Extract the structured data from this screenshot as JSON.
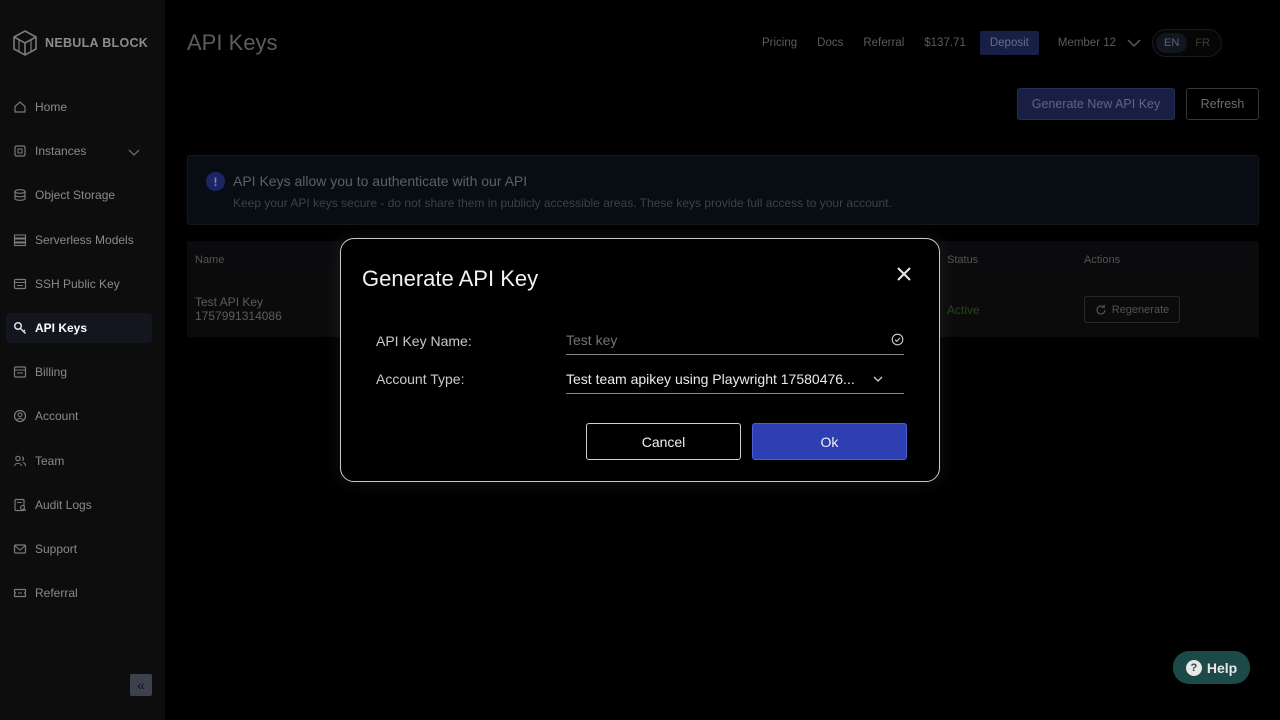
{
  "brand": {
    "name": "NEBULA BLOCK"
  },
  "sidebar": {
    "items": [
      {
        "label": "Home",
        "icon": "home-icon"
      },
      {
        "label": "Instances",
        "icon": "server-icon",
        "expandable": true
      },
      {
        "label": "Object Storage",
        "icon": "database-icon"
      },
      {
        "label": "Serverless Models",
        "icon": "layers-icon"
      },
      {
        "label": "SSH Public Key",
        "icon": "terminal-icon"
      },
      {
        "label": "API Keys",
        "icon": "key-icon",
        "active": true
      },
      {
        "label": "Billing",
        "icon": "billing-icon"
      },
      {
        "label": "Account",
        "icon": "account-icon"
      },
      {
        "label": "Team",
        "icon": "team-icon"
      },
      {
        "label": "Audit Logs",
        "icon": "audit-icon"
      },
      {
        "label": "Support",
        "icon": "mail-icon"
      },
      {
        "label": "Referral",
        "icon": "ticket-icon"
      }
    ],
    "collapse_symbol": "«"
  },
  "page": {
    "title": "API Keys"
  },
  "topnav": {
    "pricing": "Pricing",
    "docs": "Docs",
    "referral": "Referral",
    "balance": "$137.71",
    "deposit": "Deposit",
    "member": "Member 12",
    "lang_en": "EN",
    "lang_fr": "FR",
    "active_lang": "EN"
  },
  "actions": {
    "generate": "Generate New API Key",
    "refresh": "Refresh"
  },
  "info": {
    "icon_symbol": "!",
    "title": "API Keys allow you to authenticate with our API",
    "description": "Keep your API keys secure - do not share them in publicly accessible areas. These keys provide full access to your account."
  },
  "table": {
    "headers": {
      "name": "Name",
      "status": "Status",
      "actions": "Actions"
    },
    "rows": [
      {
        "name_line1": "Test API Key",
        "name_line2": "1757991314086",
        "status": "Active",
        "action": "Regenerate"
      }
    ]
  },
  "modal": {
    "title": "Generate API Key",
    "key_name_label": "API Key Name:",
    "key_name_placeholder": "Test key",
    "key_name_value": "",
    "account_type_label": "Account Type:",
    "account_type_value": "Test team apikey using Playwright 17580476...",
    "cancel": "Cancel",
    "ok": "Ok"
  },
  "help": {
    "label": "Help",
    "icon_symbol": "?"
  },
  "colors": {
    "accent": "#2d3fb3",
    "sidebar_bg": "#141414",
    "status_active": "#3a6b2c",
    "help_bg": "#1c4a48"
  }
}
